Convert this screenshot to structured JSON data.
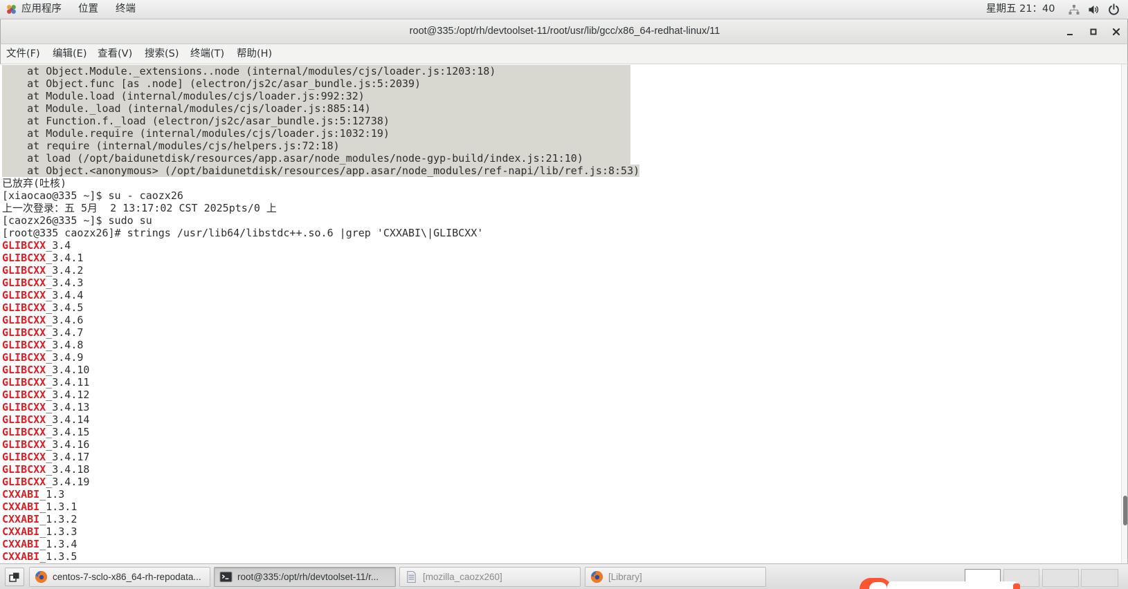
{
  "top_panel": {
    "applications": "应用程序",
    "places": "位置",
    "terminal": "终端",
    "clock": "星期五 21：40",
    "icons": [
      "applications-icon",
      "network-icon",
      "volume-icon",
      "power-icon"
    ]
  },
  "window": {
    "title": "root@335:/opt/rh/devtoolset-11/root/usr/lib/gcc/x86_64-redhat-linux/11",
    "buttons": [
      "minimize-icon",
      "maximize-icon",
      "close-icon"
    ]
  },
  "menu": {
    "items": [
      "文件(F)",
      "编辑(E)",
      "查看(V)",
      "搜索(S)",
      "终端(T)",
      "帮助(H)"
    ]
  },
  "terminal": {
    "lines": [
      {
        "text": "    at Object.Module._extensions..node (internal/modules/cjs/loader.js:1203:18)",
        "selected": true
      },
      {
        "text": "    at Object.func [as .node] (electron/js2c/asar_bundle.js:5:2039)",
        "selected": true
      },
      {
        "text": "    at Module.load (internal/modules/cjs/loader.js:992:32)",
        "selected": true
      },
      {
        "text": "    at Module._load (internal/modules/cjs/loader.js:885:14)",
        "selected": true
      },
      {
        "text": "    at Function.f._load (electron/js2c/asar_bundle.js:5:12738)",
        "selected": true
      },
      {
        "text": "    at Module.require (internal/modules/cjs/loader.js:1032:19)",
        "selected": true
      },
      {
        "text": "    at require (internal/modules/cjs/helpers.js:72:18)",
        "selected": true
      },
      {
        "text": "    at load (/opt/baidunetdisk/resources/app.asar/node_modules/node-gyp-build/index.js:21:10)",
        "selected": true
      },
      {
        "text": "    at Object.<anonymous> (/opt/baidunetdisk/resources/app.asar/node_modules/ref-napi/lib/ref.js:8:53)",
        "selected": true
      },
      {
        "text": "已放弃(吐核)"
      },
      {
        "text": "[xiaocao@335 ~]$ su - caozx26"
      },
      {
        "text": "上一次登录：五 5月  2 13:17:02 CST 2025pts/0 上"
      },
      {
        "text": "[caozx26@335 ~]$ sudo su"
      },
      {
        "text": "[root@335 caozx26]# strings /usr/lib64/libstdc++.so.6 |grep 'CXXABI\\|GLIBCXX'"
      },
      {
        "match": "GLIBCXX",
        "rest": "_3.4"
      },
      {
        "match": "GLIBCXX",
        "rest": "_3.4.1"
      },
      {
        "match": "GLIBCXX",
        "rest": "_3.4.2"
      },
      {
        "match": "GLIBCXX",
        "rest": "_3.4.3"
      },
      {
        "match": "GLIBCXX",
        "rest": "_3.4.4"
      },
      {
        "match": "GLIBCXX",
        "rest": "_3.4.5"
      },
      {
        "match": "GLIBCXX",
        "rest": "_3.4.6"
      },
      {
        "match": "GLIBCXX",
        "rest": "_3.4.7"
      },
      {
        "match": "GLIBCXX",
        "rest": "_3.4.8"
      },
      {
        "match": "GLIBCXX",
        "rest": "_3.4.9"
      },
      {
        "match": "GLIBCXX",
        "rest": "_3.4.10"
      },
      {
        "match": "GLIBCXX",
        "rest": "_3.4.11"
      },
      {
        "match": "GLIBCXX",
        "rest": "_3.4.12"
      },
      {
        "match": "GLIBCXX",
        "rest": "_3.4.13"
      },
      {
        "match": "GLIBCXX",
        "rest": "_3.4.14"
      },
      {
        "match": "GLIBCXX",
        "rest": "_3.4.15"
      },
      {
        "match": "GLIBCXX",
        "rest": "_3.4.16"
      },
      {
        "match": "GLIBCXX",
        "rest": "_3.4.17"
      },
      {
        "match": "GLIBCXX",
        "rest": "_3.4.18"
      },
      {
        "match": "GLIBCXX",
        "rest": "_3.4.19"
      },
      {
        "match": "CXXABI",
        "rest": "_1.3"
      },
      {
        "match": "CXXABI",
        "rest": "_1.3.1"
      },
      {
        "match": "CXXABI",
        "rest": "_1.3.2"
      },
      {
        "match": "CXXABI",
        "rest": "_1.3.3"
      },
      {
        "match": "CXXABI",
        "rest": "_1.3.4"
      },
      {
        "match": "CXXABI",
        "rest": "_1.3.5"
      }
    ]
  },
  "taskbar": {
    "show_desktop_icon": "show-desktop-icon",
    "tasks": [
      {
        "label": "centos-7-sclo-x86_64-rh-repodata...",
        "icon": "firefox-icon",
        "state": "normal"
      },
      {
        "label": "root@335:/opt/rh/devtoolset-11/r...",
        "icon": "terminal-icon",
        "state": "active"
      },
      {
        "label": "[mozilla_caozx260]",
        "icon": "file-icon",
        "state": "minimized"
      },
      {
        "label": "[Library]",
        "icon": "firefox-icon",
        "state": "minimized"
      }
    ],
    "workspace_switcher": {
      "count": 4,
      "active_index": 0
    }
  },
  "colors": {
    "grep_match": "#e11c22",
    "selection_bg": "#d8d8d1",
    "terminal_fg": "#2e2e2e",
    "terminal_bg": "#ffffff",
    "widget_accent": "#fc5531"
  }
}
